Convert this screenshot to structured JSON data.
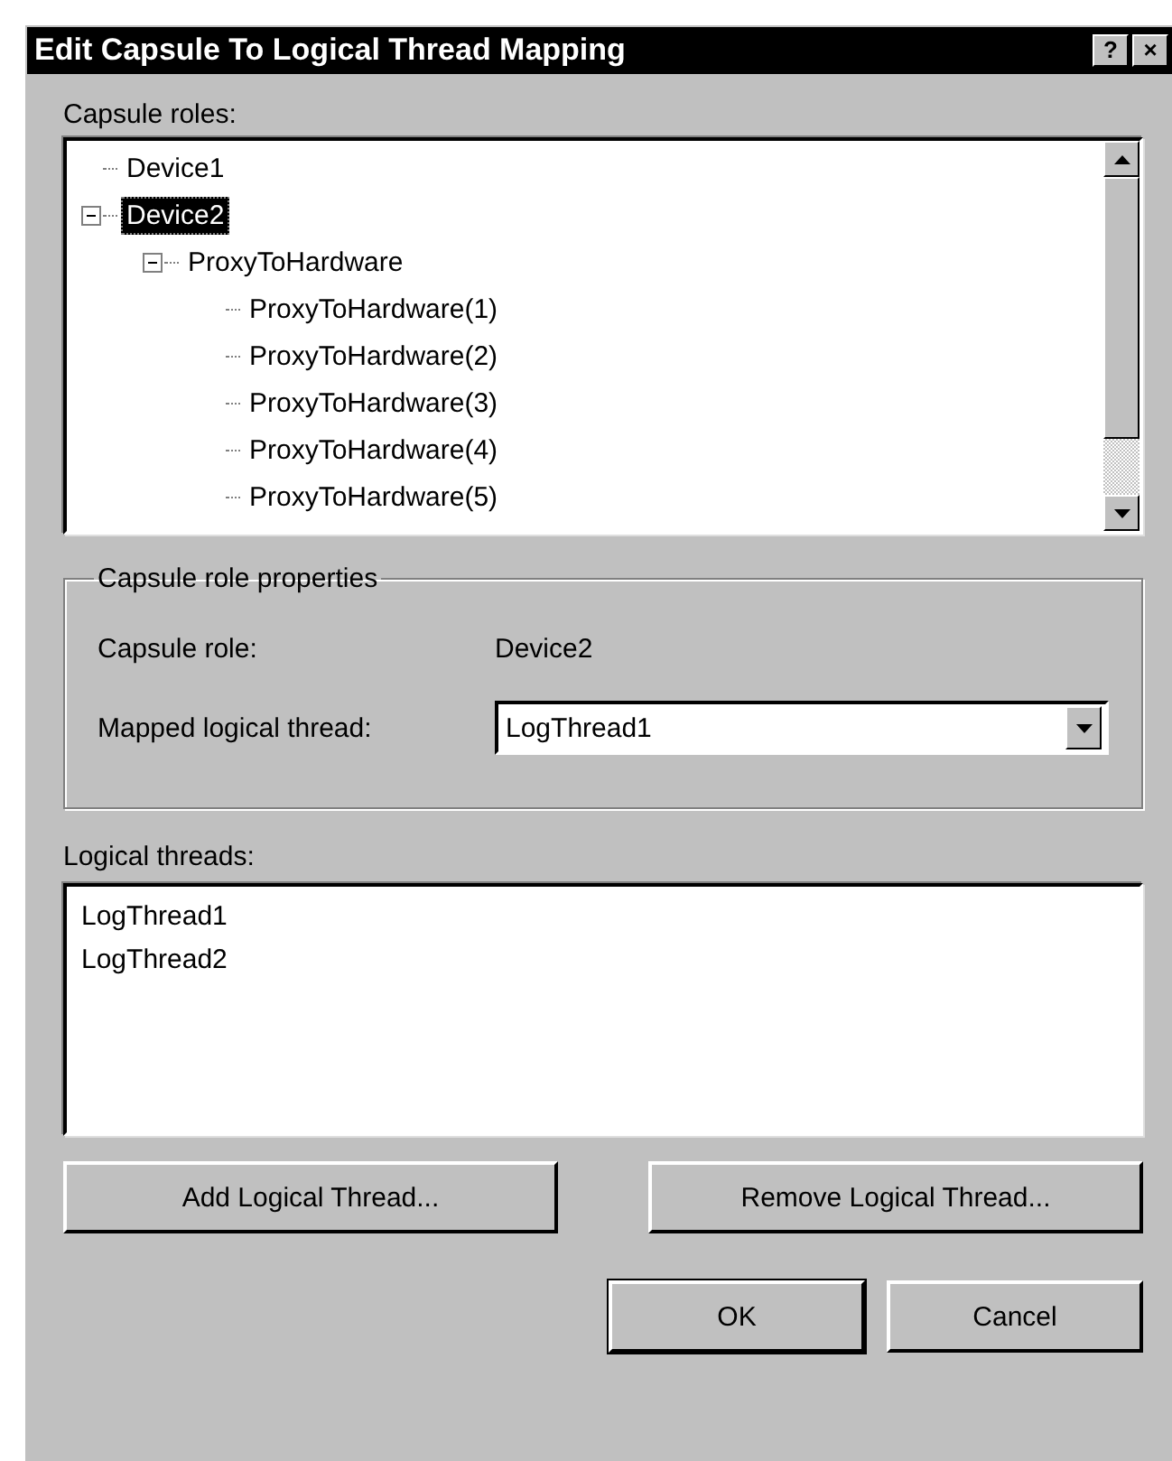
{
  "window": {
    "title": "Edit Capsule To Logical Thread Mapping",
    "title_buttons": [
      "?",
      "×"
    ]
  },
  "capsule_roles": {
    "label": "Capsule roles:",
    "tree": [
      {
        "label": "Device1",
        "selected": false
      },
      {
        "label": "Device2",
        "selected": true,
        "expanded": true,
        "children": [
          {
            "label": "ProxyToHardware",
            "selected": false,
            "expanded": true,
            "children": [
              {
                "label": "ProxyToHardware(1)",
                "selected": false
              },
              {
                "label": "ProxyToHardware(2)",
                "selected": false
              },
              {
                "label": "ProxyToHardware(3)",
                "selected": false
              },
              {
                "label": "ProxyToHardware(4)",
                "selected": false
              },
              {
                "label": "ProxyToHardware(5)",
                "selected": false
              }
            ]
          }
        ]
      }
    ]
  },
  "properties": {
    "title": "Capsule role properties",
    "capsule_role_label": "Capsule role:",
    "capsule_role_value": "Device2",
    "mapped_label": "Mapped logical thread:",
    "mapped_value": "LogThread1"
  },
  "logical_threads": {
    "label": "Logical threads:",
    "items": [
      "LogThread1",
      "LogThread2"
    ]
  },
  "buttons": {
    "add": "Add Logical Thread...",
    "remove": "Remove Logical Thread...",
    "ok": "OK",
    "cancel": "Cancel"
  }
}
